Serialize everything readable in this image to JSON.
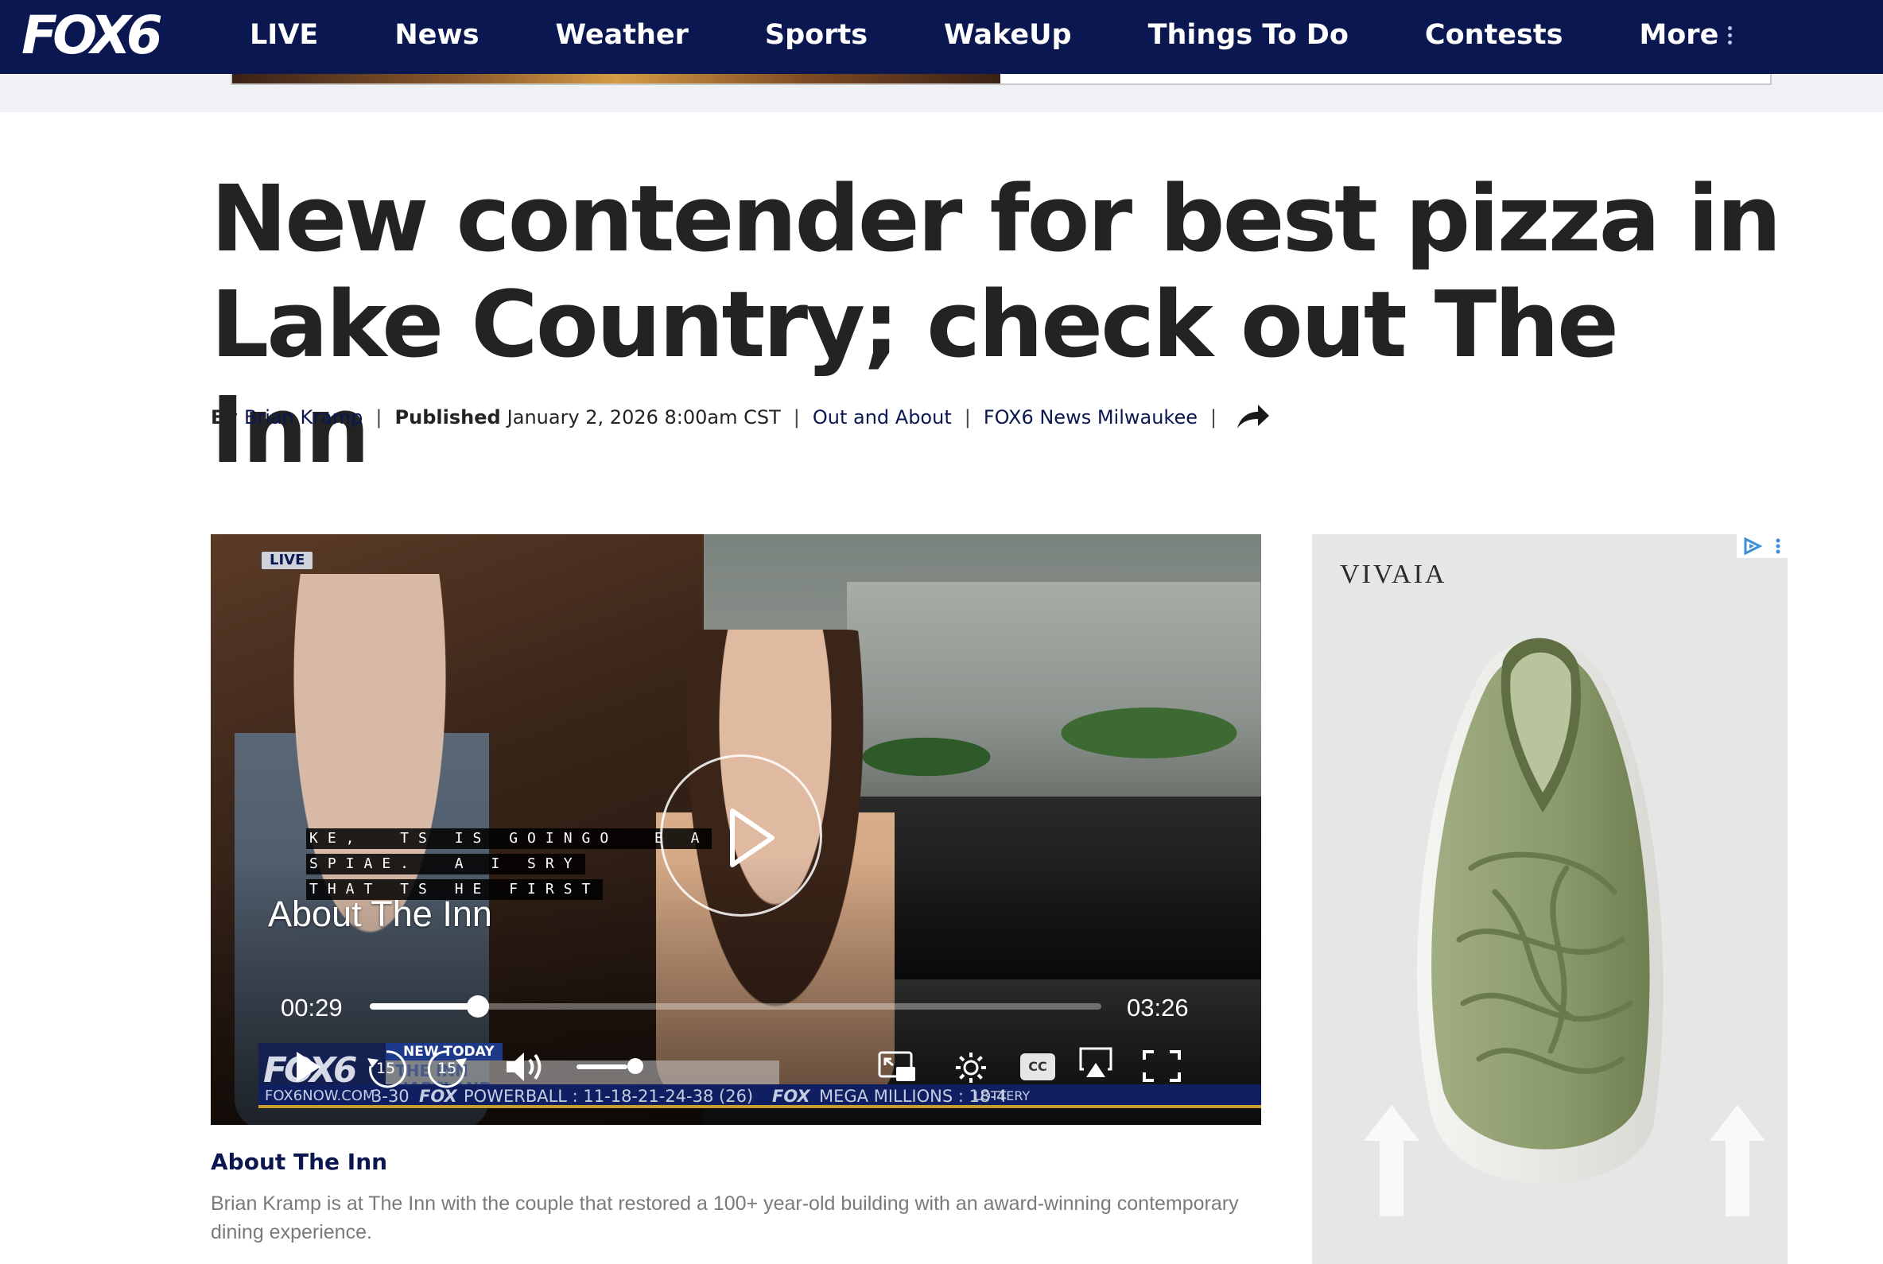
{
  "site": {
    "logo_text": "FOX6",
    "brand_color": "#0a1751"
  },
  "nav": {
    "items": [
      {
        "label": "LIVE"
      },
      {
        "label": "News"
      },
      {
        "label": "Weather"
      },
      {
        "label": "Sports"
      },
      {
        "label": "WakeUp"
      },
      {
        "label": "Things To Do"
      },
      {
        "label": "Contests"
      },
      {
        "label": "More"
      }
    ]
  },
  "article": {
    "headline": "New contender for best pizza in Lake Country; check out The Inn",
    "byline": {
      "by_label": "By",
      "author": "Brian Kramp",
      "published_label": "Published",
      "published_date": "January 2, 2026 8:00am CST",
      "category": "Out and About",
      "source": "FOX6 News Milwaukee",
      "share_icon": "share-arrow-icon"
    }
  },
  "video": {
    "live_tag": "LIVE",
    "caption_lines": [
      "KE,  TS IS GOINGO  E A",
      "SPIAE.  A I SRY",
      "THAT TS HE FIRST"
    ],
    "title_overlay": "About The Inn",
    "current_time": "00:29",
    "duration": "03:26",
    "progress_fraction": 0.148,
    "volume_fraction": 0.85,
    "skip_back_label": "15",
    "skip_forward_label": "15",
    "cc_label": "CC",
    "ticker": {
      "logo": "FOX6",
      "new_today": "NEW TODAY",
      "story": "THE INN\nHARTLAND"
    },
    "lottery": {
      "site": "FOX6NOW.COM",
      "numbers_tail": "3-30",
      "fox1": "FOX",
      "powerball": "POWERBALL : 11-18-21-24-38 (26)",
      "fox2": "FOX",
      "mega": "MEGA MILLIONS : 18-4",
      "lottery_label": "LOTTERY"
    },
    "caption_title": "About The Inn",
    "caption_desc": "Brian Kramp is at The Inn with the couple that restored a 100+ year-old building with an award-winning contemporary dining experience."
  },
  "ad": {
    "brand": "VIVAIA",
    "product_color": "#8a9a6a"
  }
}
